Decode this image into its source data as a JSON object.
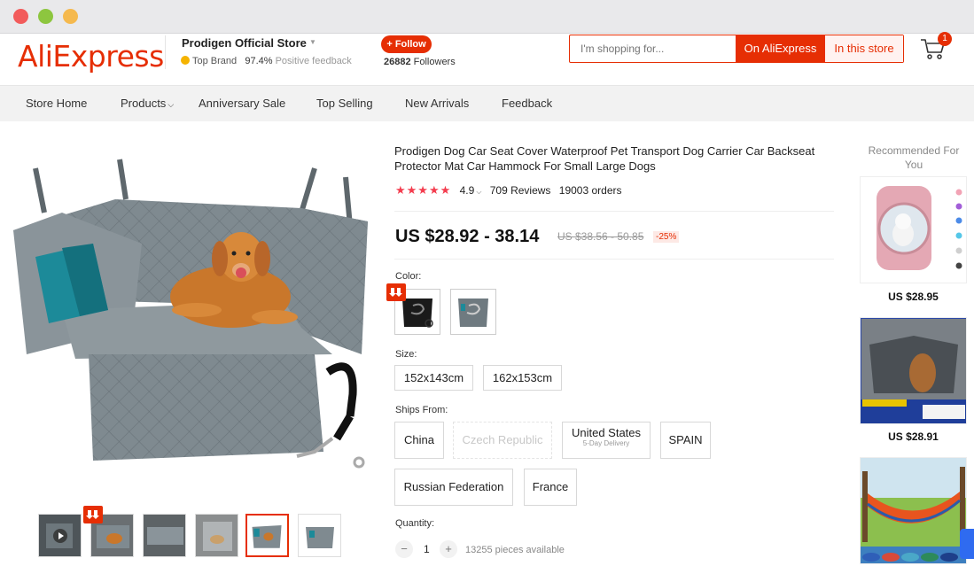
{
  "header": {
    "logo": "AliExpress",
    "store_name": "Prodigen Official Store",
    "top_brand": "Top Brand",
    "feedback_pct": "97.4%",
    "feedback_label": "Positive feedback",
    "follow_label": "+ Follow",
    "followers_count": "26882",
    "followers_label": "Followers",
    "search_placeholder": "I'm shopping for...",
    "search_aliexpress": "On AliExpress",
    "search_store": "In this store",
    "cart_count": "1"
  },
  "nav": {
    "items": [
      "Store Home",
      "Products",
      "Anniversary Sale",
      "Top Selling",
      "New Arrivals",
      "Feedback"
    ]
  },
  "product": {
    "title": "Prodigen Dog Car Seat Cover Waterproof Pet Transport Dog Carrier Car Backseat Protector Mat Car Hammock For Small Large Dogs",
    "stars": "★★★★★",
    "rating": "4.9",
    "reviews": "709 Reviews",
    "orders": "19003 orders",
    "price": "US $28.92 - 38.14",
    "original_price": "US $38.56 - 50.85",
    "discount": "-25%",
    "color_label": "Color:",
    "size_label": "Size:",
    "sizes": [
      "152x143cm",
      "162x153cm"
    ],
    "ships_label": "Ships From:",
    "ships_from": [
      "China",
      "Czech Republic",
      "United States",
      "SPAIN",
      "Russian Federation",
      "France"
    ],
    "us_delivery": "5-Day Delivery",
    "quantity_label": "Quantity:",
    "quantity": "1",
    "qty_minus": "−",
    "qty_plus": "+",
    "available": "13255 pieces available"
  },
  "recommended": {
    "title": "Recommended For You",
    "prices": [
      "US $28.95",
      "US $28.91"
    ]
  },
  "colors": {
    "accent": "#e62e04",
    "star": "#f43d4f",
    "cover": "#7f8a90"
  }
}
